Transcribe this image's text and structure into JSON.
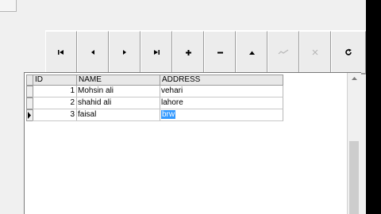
{
  "window": {
    "title": ""
  },
  "navigator": {
    "buttons": [
      {
        "name": "first-record-button",
        "icon": "first-record-icon",
        "enabled": true
      },
      {
        "name": "prior-record-button",
        "icon": "prior-record-icon",
        "enabled": true
      },
      {
        "name": "next-record-button",
        "icon": "next-record-icon",
        "enabled": true
      },
      {
        "name": "last-record-button",
        "icon": "last-record-icon",
        "enabled": true
      },
      {
        "name": "insert-record-button",
        "icon": "plus-icon",
        "enabled": true
      },
      {
        "name": "delete-record-button",
        "icon": "minus-icon",
        "enabled": true
      },
      {
        "name": "edit-record-button",
        "icon": "edit-arrow-icon",
        "enabled": true
      },
      {
        "name": "post-edit-button",
        "icon": "checkmark-icon",
        "enabled": false
      },
      {
        "name": "cancel-edit-button",
        "icon": "x-icon",
        "enabled": false
      },
      {
        "name": "refresh-data-button",
        "icon": "refresh-icon",
        "enabled": true
      }
    ]
  },
  "grid": {
    "columns": [
      "ID",
      "NAME",
      "ADDRESS"
    ],
    "rows": [
      {
        "id": "1",
        "name": "Mohsin ali",
        "address": "vehari"
      },
      {
        "id": "2",
        "name": "shahid ali",
        "address": "lahore"
      },
      {
        "id": "3",
        "name": "faisal",
        "address": "brw"
      }
    ],
    "current_row": 3
  },
  "colors": {
    "selection": "#3399ff",
    "disabled_icon": "#b8b8b8"
  }
}
